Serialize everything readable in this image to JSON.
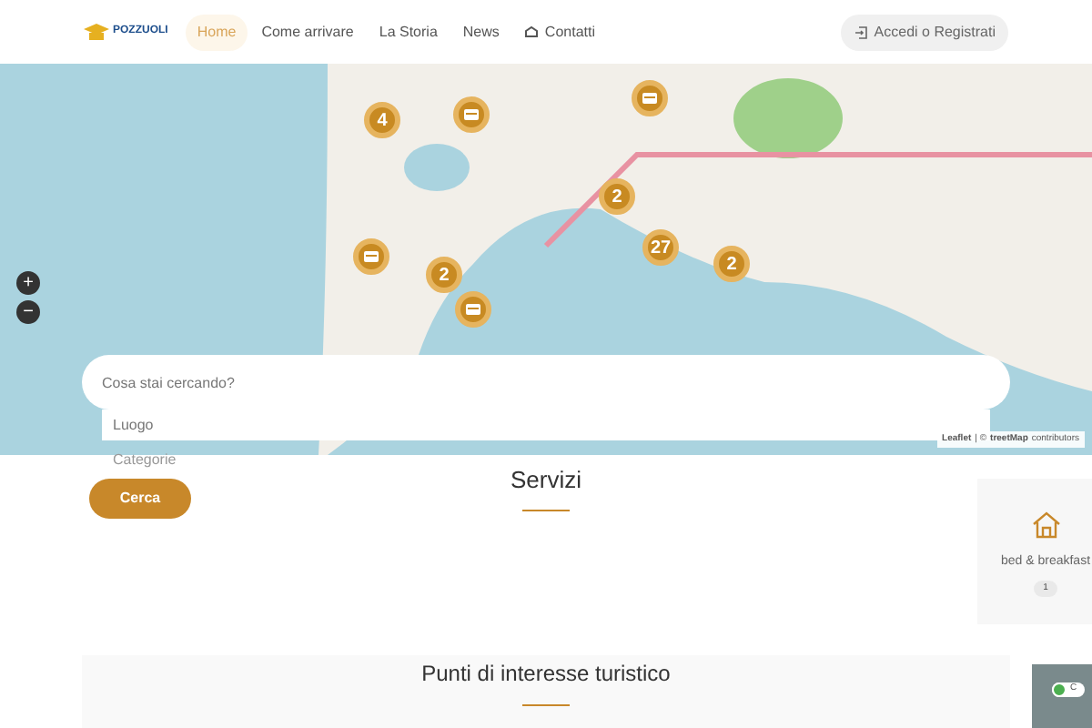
{
  "header": {
    "logo_text": "POZZUOLI",
    "nav": [
      {
        "label": "Home",
        "selected": true
      },
      {
        "label": "Come arrivare",
        "selected": false
      },
      {
        "label": "La Storia",
        "selected": false
      },
      {
        "label": "News",
        "selected": false
      },
      {
        "label": "Contatti",
        "selected": false,
        "icon": true
      }
    ],
    "login": "Accedi o Registrati"
  },
  "map": {
    "zoom_in": "+",
    "zoom_out": "−",
    "markers": [
      {
        "kind": "cluster",
        "count": "4"
      },
      {
        "kind": "poi"
      },
      {
        "kind": "poi"
      },
      {
        "kind": "cluster",
        "count": "2"
      },
      {
        "kind": "cluster",
        "count": "27"
      },
      {
        "kind": "cluster",
        "count": "2"
      },
      {
        "kind": "poi"
      },
      {
        "kind": "cluster",
        "count": "2"
      },
      {
        "kind": "poi"
      }
    ],
    "attribution_leaflet": "Leaflet",
    "attribution_sep": "| ©",
    "attribution_osm": "treetMap",
    "attribution_rest": "contributors"
  },
  "search": {
    "placeholder": "Cosa stai cercando?",
    "luogo_placeholder": "Luogo",
    "categorie_placeholder": "Categorie",
    "button": "Cerca"
  },
  "servizi": {
    "title": "Servizi",
    "cards": [
      {
        "label": "bed & breakfast",
        "count": "1"
      }
    ]
  },
  "punti": {
    "title": "Punti di interesse turistico",
    "preview_text": "C"
  }
}
